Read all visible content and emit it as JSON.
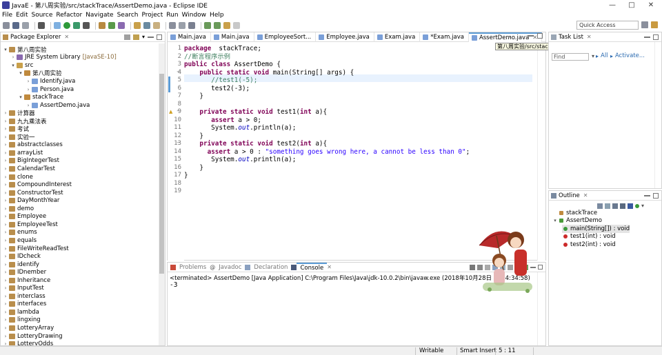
{
  "window": {
    "title": "JavaE - 第八周实验/src/stackTrace/AssertDemo.java - Eclipse IDE"
  },
  "menu": [
    "File",
    "Edit",
    "Source",
    "Refactor",
    "Navigate",
    "Search",
    "Project",
    "Run",
    "Window",
    "Help"
  ],
  "toolbar": {
    "quick_access_placeholder": "Quick Access"
  },
  "package_explorer": {
    "title": "Package Explorer",
    "items": [
      {
        "label": "第八周实验",
        "twisty": "open",
        "icon": "project-icon",
        "depth": 0
      },
      {
        "label": "JRE System Library",
        "suffix": "[JavaSE-10]",
        "twisty": "closed",
        "icon": "library-icon",
        "depth": 1
      },
      {
        "label": "src",
        "twisty": "open",
        "icon": "source-folder-icon",
        "depth": 1
      },
      {
        "label": "第八周实验",
        "twisty": "open",
        "icon": "package-icon",
        "depth": 2
      },
      {
        "label": "Identify.java",
        "twisty": "closed",
        "icon": "java-file-icon",
        "depth": 3
      },
      {
        "label": "Person.java",
        "twisty": "closed",
        "icon": "java-file-icon",
        "depth": 3
      },
      {
        "label": "stackTrace",
        "twisty": "open",
        "icon": "package-icon",
        "depth": 2
      },
      {
        "label": "AssertDemo.java",
        "twisty": "closed",
        "icon": "java-file-icon",
        "depth": 3
      },
      {
        "label": "计算器",
        "twisty": "closed",
        "icon": "project-icon",
        "depth": 0
      },
      {
        "label": "九九乘法表",
        "twisty": "closed",
        "icon": "project-icon",
        "depth": 0
      },
      {
        "label": "考试",
        "twisty": "closed",
        "icon": "project-icon",
        "depth": 0
      },
      {
        "label": "实验一",
        "twisty": "closed",
        "icon": "project-icon",
        "depth": 0
      },
      {
        "label": "abstractclasses",
        "twisty": "closed",
        "icon": "project-icon",
        "depth": 0
      },
      {
        "label": "arrayList",
        "twisty": "closed",
        "icon": "project-icon",
        "depth": 0
      },
      {
        "label": "BigIntegerTest",
        "twisty": "closed",
        "icon": "project-icon",
        "depth": 0
      },
      {
        "label": "CalendarTest",
        "twisty": "closed",
        "icon": "project-icon",
        "depth": 0
      },
      {
        "label": "clone",
        "twisty": "closed",
        "icon": "project-icon",
        "depth": 0
      },
      {
        "label": "CompoundInterest",
        "twisty": "closed",
        "icon": "project-icon",
        "depth": 0
      },
      {
        "label": "ConstructorTest",
        "twisty": "closed",
        "icon": "project-icon",
        "depth": 0
      },
      {
        "label": "DayMonthYear",
        "twisty": "closed",
        "icon": "project-icon",
        "depth": 0
      },
      {
        "label": "demo",
        "twisty": "closed",
        "icon": "project-icon",
        "depth": 0
      },
      {
        "label": "Employee",
        "twisty": "closed",
        "icon": "project-icon",
        "depth": 0
      },
      {
        "label": "EmployeeTest",
        "twisty": "closed",
        "icon": "project-icon",
        "depth": 0
      },
      {
        "label": "enums",
        "twisty": "closed",
        "icon": "project-icon",
        "depth": 0
      },
      {
        "label": "equals",
        "twisty": "closed",
        "icon": "project-icon",
        "depth": 0
      },
      {
        "label": "FileWriteReadTest",
        "twisty": "closed",
        "icon": "project-icon",
        "depth": 0
      },
      {
        "label": "IDcheck",
        "twisty": "closed",
        "icon": "project-icon",
        "depth": 0
      },
      {
        "label": "identify",
        "twisty": "closed",
        "icon": "project-icon",
        "depth": 0
      },
      {
        "label": "IDnember",
        "twisty": "closed",
        "icon": "project-icon",
        "depth": 0
      },
      {
        "label": "Inheritance",
        "twisty": "closed",
        "icon": "project-icon",
        "depth": 0
      },
      {
        "label": "InputTest",
        "twisty": "closed",
        "icon": "project-icon",
        "depth": 0
      },
      {
        "label": "interclass",
        "twisty": "closed",
        "icon": "project-icon",
        "depth": 0
      },
      {
        "label": "interfaces",
        "twisty": "closed",
        "icon": "project-icon",
        "depth": 0
      },
      {
        "label": "lambda",
        "twisty": "closed",
        "icon": "project-icon",
        "depth": 0
      },
      {
        "label": "lingxing",
        "twisty": "closed",
        "icon": "project-icon",
        "depth": 0
      },
      {
        "label": "LotteryArray",
        "twisty": "closed",
        "icon": "project-icon",
        "depth": 0
      },
      {
        "label": "LotteryDrawing",
        "twisty": "closed",
        "icon": "project-icon",
        "depth": 0
      },
      {
        "label": "LotteryOdds",
        "twisty": "closed",
        "icon": "project-icon",
        "depth": 0
      }
    ]
  },
  "editor": {
    "tabs": [
      {
        "label": "Main.java",
        "active": false
      },
      {
        "label": "Main.java",
        "active": false
      },
      {
        "label": "EmployeeSort...",
        "active": false
      },
      {
        "label": "Employee.java",
        "active": false
      },
      {
        "label": "Exam.java",
        "active": false
      },
      {
        "label": "*Exam.java",
        "active": false
      },
      {
        "label": "AssertDemo.java",
        "active": true
      }
    ],
    "tooltip": "第八周实验/src/stackTrace/AssertDemo.java",
    "lines": [
      "1",
      "2",
      "3",
      "4",
      "5",
      "6",
      "7",
      "8",
      "9",
      "10",
      "11",
      "12",
      "13",
      "14",
      "15",
      "16",
      "17",
      "18",
      "19"
    ],
    "code": [
      [
        [
          "kw",
          "package"
        ],
        [
          "",
          "  stackTrace;"
        ]
      ],
      [
        [
          "cm",
          "//断言程序示例"
        ]
      ],
      [
        [
          "kw",
          "public"
        ],
        [
          "",
          ""
        ],
        [
          "kw",
          " class"
        ],
        [
          "",
          " AssertDemo {"
        ]
      ],
      [
        [
          "",
          "    "
        ],
        [
          "kw",
          "public static void"
        ],
        [
          "",
          " main(String[] args) {"
        ]
      ],
      [
        [
          "",
          "       "
        ],
        [
          "cm",
          "//test1(-5);"
        ]
      ],
      [
        [
          "",
          "       test2(-3);"
        ]
      ],
      [
        [
          "",
          "    }"
        ]
      ],
      [
        [
          "",
          ""
        ]
      ],
      [
        [
          "",
          "    "
        ],
        [
          "kw",
          "private static void"
        ],
        [
          "",
          " test1("
        ],
        [
          "kw",
          "int"
        ],
        [
          "",
          " a){"
        ]
      ],
      [
        [
          "",
          "       "
        ],
        [
          "kw",
          "assert"
        ],
        [
          "",
          " a > 0;"
        ]
      ],
      [
        [
          "",
          "       System."
        ],
        [
          "fi",
          "out"
        ],
        [
          "",
          ".println(a);"
        ]
      ],
      [
        [
          "",
          "    }"
        ]
      ],
      [
        [
          "",
          "    "
        ],
        [
          "kw",
          "private static void"
        ],
        [
          "",
          " test2("
        ],
        [
          "kw",
          "int"
        ],
        [
          "",
          " a){"
        ]
      ],
      [
        [
          "",
          "      "
        ],
        [
          "kw",
          "assert"
        ],
        [
          "",
          " a > 0 : "
        ],
        [
          "st",
          "\"something goes wrong here, a cannot be less than 0\""
        ],
        [
          "",
          ";"
        ]
      ],
      [
        [
          "",
          "       System."
        ],
        [
          "fi",
          "out"
        ],
        [
          "",
          ".println(a);"
        ]
      ],
      [
        [
          "",
          "    }"
        ]
      ],
      [
        [
          "",
          "}"
        ]
      ],
      [
        [
          "",
          ""
        ]
      ],
      [
        [
          "",
          ""
        ]
      ]
    ]
  },
  "console": {
    "tabs": [
      "Problems",
      "Javadoc",
      "Declaration",
      "Console"
    ],
    "active_tab": "Console",
    "status": "<terminated> AssertDemo [Java Application] C:\\Program Files\\Java\\jdk-10.0.2\\bin\\javaw.exe (2018年10月28日 下午4:34:58)",
    "output": "-3"
  },
  "task_list": {
    "title": "Task List",
    "find_placeholder": "Find",
    "all_label": "All",
    "activate_label": "Activate..."
  },
  "outline": {
    "title": "Outline",
    "items": [
      {
        "label": "stackTrace",
        "depth": 0,
        "icon": "package-icon",
        "color": "#c08a3e"
      },
      {
        "label": "AssertDemo",
        "depth": 0,
        "icon": "class-icon",
        "color": "#4a9a3a"
      },
      {
        "label": "main(String[]) : void",
        "depth": 1,
        "icon": "public-method-icon",
        "color": "#3a9a3a"
      },
      {
        "label": "test1(int) : void",
        "depth": 1,
        "icon": "private-method-icon",
        "color": "#cc2a2a"
      },
      {
        "label": "test2(int) : void",
        "depth": 1,
        "icon": "private-method-icon",
        "color": "#cc2a2a"
      }
    ]
  },
  "statusbar": {
    "writable": "Writable",
    "insert_mode": "Smart Insert",
    "position": "5 : 11"
  },
  "colors": {
    "keyword": "#7f0055",
    "comment": "#3f7f5f",
    "string": "#2a00ff",
    "field": "#0000c0",
    "active_tab_accent": "#5b9bd5"
  }
}
